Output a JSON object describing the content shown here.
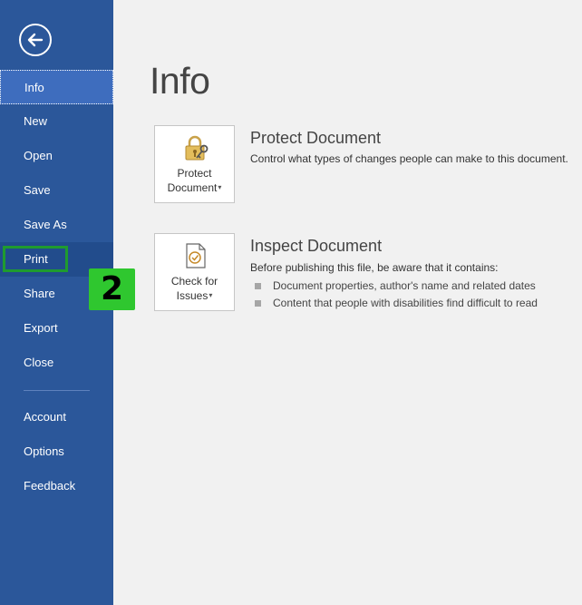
{
  "nav": {
    "back_icon": "back-arrow-icon",
    "items": [
      {
        "label": "Info"
      },
      {
        "label": "New"
      },
      {
        "label": "Open"
      },
      {
        "label": "Save"
      },
      {
        "label": "Save As"
      },
      {
        "label": "Print"
      },
      {
        "label": "Share"
      },
      {
        "label": "Export"
      },
      {
        "label": "Close"
      },
      {
        "label": "Account"
      },
      {
        "label": "Options"
      },
      {
        "label": "Feedback"
      }
    ]
  },
  "annotation": {
    "step": "2",
    "color": "#2fc72f"
  },
  "main": {
    "title": "Info",
    "protect": {
      "tile_line1": "Protect",
      "tile_line2": "Document",
      "icon": "lock-key-icon",
      "heading": "Protect Document",
      "description": "Control what types of changes people can make to this document."
    },
    "inspect": {
      "tile_line1": "Check for",
      "tile_line2": "Issues",
      "icon": "document-check-icon",
      "heading": "Inspect Document",
      "description": "Before publishing this file, be aware that it contains:",
      "bullets": [
        "Document properties, author's name and related dates",
        "Content that people with disabilities find difficult to read"
      ]
    }
  },
  "colors": {
    "sidebar": "#2b579a",
    "active": "#3e6dbe",
    "background": "#f1f1f1",
    "highlight_box": "#1f9b2f"
  }
}
